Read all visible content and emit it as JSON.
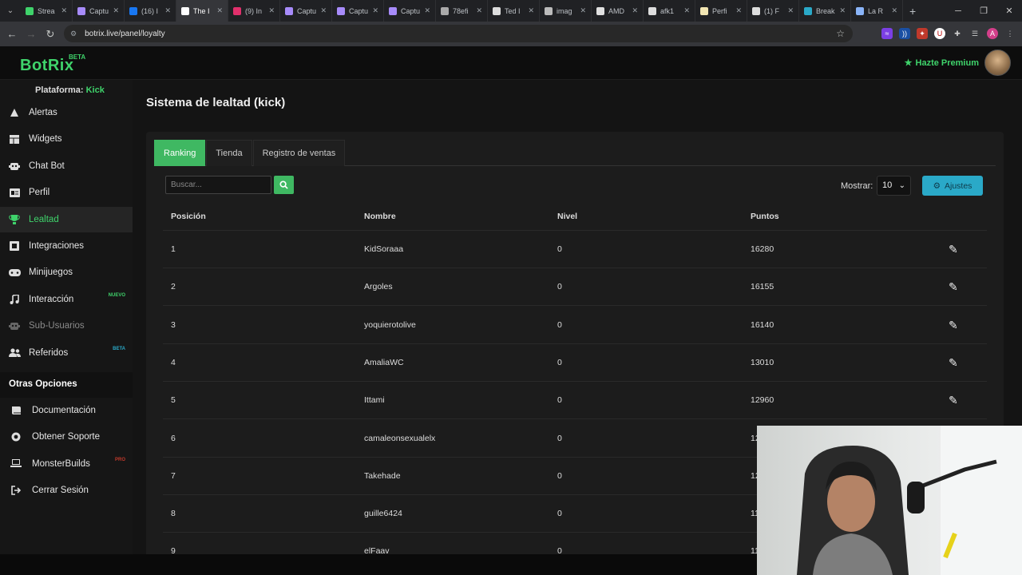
{
  "browser": {
    "tabs": [
      {
        "title": "Strea",
        "color": "#3fd36b"
      },
      {
        "title": "Captu",
        "color": "#a78bfa"
      },
      {
        "title": "(16) I",
        "color": "#1877f2"
      },
      {
        "title": "The I",
        "color": "#ffffff"
      },
      {
        "title": "(9) In",
        "color": "#e1306c"
      },
      {
        "title": "Captu",
        "color": "#a78bfa"
      },
      {
        "title": "Captu",
        "color": "#a78bfa"
      },
      {
        "title": "Captu",
        "color": "#a78bfa"
      },
      {
        "title": "78efi",
        "color": "#aaaaaa"
      },
      {
        "title": "Ted I",
        "color": "#dddddd"
      },
      {
        "title": "imag",
        "color": "#bbbbbb"
      },
      {
        "title": "AMD",
        "color": "#e0e0e0"
      },
      {
        "title": "afk1",
        "color": "#dddddd"
      },
      {
        "title": "Perfi",
        "color": "#f2e6b3"
      },
      {
        "title": "(1) F",
        "color": "#dddddd"
      },
      {
        "title": "Break",
        "color": "#2aa9c8"
      },
      {
        "title": "La R",
        "color": "#8ab4f8"
      }
    ],
    "active_tab_index": 3,
    "url": "botrix.live/panel/loyalty"
  },
  "header": {
    "logo": "BotRix",
    "logo_badge": "BETA",
    "premium_label": "Hazte Premium"
  },
  "sidebar": {
    "platform_label": "Plataforma:",
    "platform_value": "Kick",
    "items": [
      {
        "label": "Alertas",
        "icon": "warning-icon"
      },
      {
        "label": "Widgets",
        "icon": "grid-icon"
      },
      {
        "label": "Chat Bot",
        "icon": "robot-icon"
      },
      {
        "label": "Perfil",
        "icon": "id-card-icon"
      },
      {
        "label": "Lealtad",
        "icon": "trophy-icon"
      },
      {
        "label": "Integraciones",
        "icon": "plug-icon"
      },
      {
        "label": "Minijuegos",
        "icon": "gamepad-icon"
      },
      {
        "label": "Interacción",
        "icon": "music-icon",
        "badge": "NUEVO"
      },
      {
        "label": "Sub-Usuarios",
        "icon": "robot-icon"
      },
      {
        "label": "Referidos",
        "icon": "users-icon",
        "badge": "BETA"
      }
    ],
    "section_title": "Otras Opciones",
    "other_items": [
      {
        "label": "Documentación",
        "icon": "book-icon"
      },
      {
        "label": "Obtener Soporte",
        "icon": "lifebuoy-icon"
      },
      {
        "label": "MonsterBuilds",
        "icon": "laptop-icon",
        "badge": "PRO"
      },
      {
        "label": "Cerrar Sesión",
        "icon": "sign-out-icon"
      }
    ]
  },
  "main": {
    "title": "Sistema de lealtad (kick)",
    "tabs": [
      "Ranking",
      "Tienda",
      "Registro de ventas"
    ],
    "search_placeholder": "Buscar...",
    "show_label": "Mostrar:",
    "show_value": "10",
    "settings_label": "Ajustes",
    "table": {
      "headers": [
        "Posición",
        "Nombre",
        "Nivel",
        "Puntos"
      ],
      "rows": [
        {
          "pos": "1",
          "name": "KidSoraaa",
          "level": "0",
          "points": "16280"
        },
        {
          "pos": "2",
          "name": "Argoles",
          "level": "0",
          "points": "16155"
        },
        {
          "pos": "3",
          "name": "yoquierotolive",
          "level": "0",
          "points": "16140"
        },
        {
          "pos": "4",
          "name": "AmaliaWC",
          "level": "0",
          "points": "13010"
        },
        {
          "pos": "5",
          "name": "Ittami",
          "level": "0",
          "points": "12960"
        },
        {
          "pos": "6",
          "name": "camaleonsexualelx",
          "level": "0",
          "points": "12"
        },
        {
          "pos": "7",
          "name": "Takehade",
          "level": "0",
          "points": "12"
        },
        {
          "pos": "8",
          "name": "guille6424",
          "level": "0",
          "points": "11"
        },
        {
          "pos": "9",
          "name": "elFaav",
          "level": "0",
          "points": "11"
        }
      ]
    }
  },
  "colors": {
    "accent": "#3fd36b",
    "settings_button": "#2aa9c8"
  }
}
